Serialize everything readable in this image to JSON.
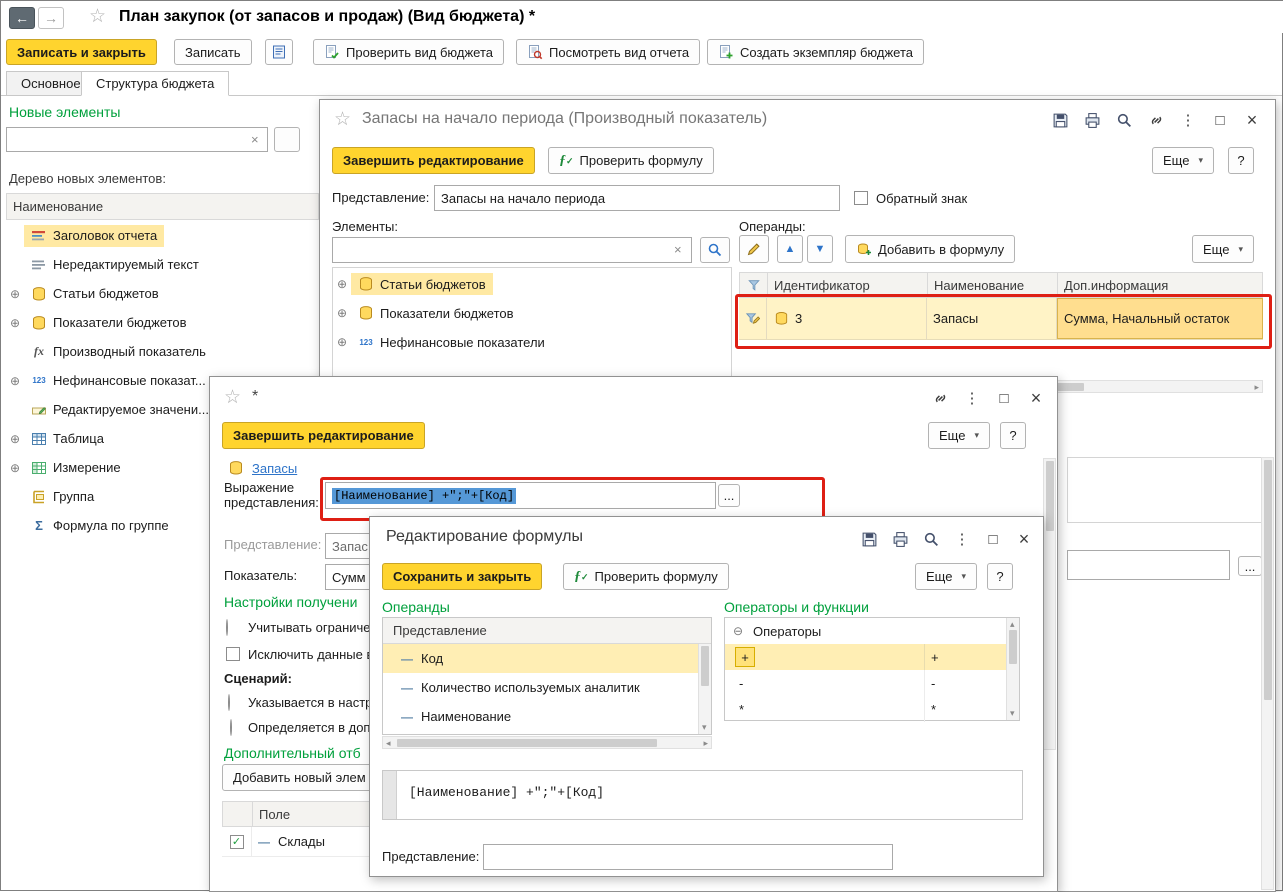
{
  "glyphs": {
    "back": "←",
    "forward": "→",
    "star": "☆",
    "close": "×",
    "maximize": "□",
    "dots": "⋮",
    "more_arrow": "▾",
    "up_arrow": "▲",
    "down_arrow": "▼",
    "left_arrow": "◂",
    "right_arrow": "▸",
    "up_small": "▴",
    "down_small": "▾",
    "check": "✓",
    "expand": "⊕",
    "collapse": "⊖",
    "dash": "—",
    "clear": "×",
    "ellipsis": "..."
  },
  "colors": {
    "accent_yellow": "#FFD42E",
    "header_green": "#00A03C",
    "annotation_red": "#DE1F14",
    "selection_blue": "#5598D7",
    "row_highlight": "#FFF3C6",
    "cell_highlight": "#FFDE8F",
    "link_blue": "#2E74C9"
  },
  "header": {
    "title": "План закупок (от запасов и продаж) (Вид бюджета) *"
  },
  "toolbar": {
    "save_close": "Записать и закрыть",
    "save": "Записать",
    "check_view": "Проверить вид бюджета",
    "view_report": "Посмотреть вид отчета",
    "create_instance": "Создать экземпляр бюджета"
  },
  "tabs": {
    "main": "Основное",
    "structure": "Структура бюджета"
  },
  "left_panel": {
    "header": "Новые элементы",
    "tree_caption": "Дерево новых элементов:",
    "column": "Наименование",
    "items": [
      {
        "label": "Заголовок отчета"
      },
      {
        "label": "Нередактируемый текст"
      },
      {
        "label": "Статьи бюджетов"
      },
      {
        "label": "Показатели бюджетов"
      },
      {
        "label": "Производный показатель"
      },
      {
        "label": "Нефинансовые показат..."
      },
      {
        "label": "Редактируемое значени..."
      },
      {
        "label": "Таблица"
      },
      {
        "label": "Измерение"
      },
      {
        "label": "Группа"
      },
      {
        "label": "Формула по группе"
      }
    ]
  },
  "dialog_indicator": {
    "title": "Запасы на начало периода (Производный показатель)",
    "finish": "Завершить редактирование",
    "check_formula": "Проверить формулу",
    "more": "Еще",
    "help": "?",
    "presentation_label": "Представление:",
    "presentation_value": "Запасы на начало периода",
    "reverse_sign": "Обратный знак",
    "elements_label": "Элементы:",
    "tree": [
      "Статьи бюджетов",
      "Показатели бюджетов",
      "Нефинансовые показатели"
    ],
    "operands_label": "Операнды:",
    "add_to_formula": "Добавить в формулу",
    "columns": {
      "id": "Идентификатор",
      "name": "Наименование",
      "info": "Доп.информация"
    },
    "row": {
      "id": "3",
      "name": "Запасы",
      "info": "Сумма, Начальный остаток"
    }
  },
  "dialog_element": {
    "title": "*",
    "finish": "Завершить редактирование",
    "more": "Еще",
    "help": "?",
    "link": "Запасы",
    "expression_label_1": "Выражение",
    "expression_label_2": "представления:",
    "expression_value": "[Наименование] +\";\"+[Код]",
    "presentation_label": "Представление:",
    "presentation_value": "Запас",
    "indicator_label": "Показатель:",
    "indicator_value": "Сумм",
    "settings_header": "Настройки получени",
    "option_limit": "Учитывать ограничен",
    "option_exclude": "Исключить данные в",
    "scenario_label": "Сценарий:",
    "option_in_settings": "Указывается в настр",
    "option_in_add": "Определяется в доп",
    "filter_header": "Дополнительный отб",
    "add_button": "Добавить новый элем",
    "column_field": "Поле",
    "row_field": "Склады"
  },
  "dialog_formula": {
    "title": "Редактирование формулы",
    "save": "Сохранить и закрыть",
    "check": "Проверить формулу",
    "more": "Еще",
    "help": "?",
    "operands_header": "Операнды",
    "operators_header": "Операторы и функции",
    "operands_column": "Представление",
    "operands": [
      "Код",
      "Количество используемых аналитик",
      "Наименование"
    ],
    "operators_group": "Операторы",
    "operators": [
      {
        "sign": "+"
      },
      {
        "sign": "-"
      },
      {
        "sign": "*"
      }
    ],
    "formula": "[Наименование] +\";\"+[Код]",
    "presentation_label": "Представление:",
    "presentation_value": ""
  }
}
